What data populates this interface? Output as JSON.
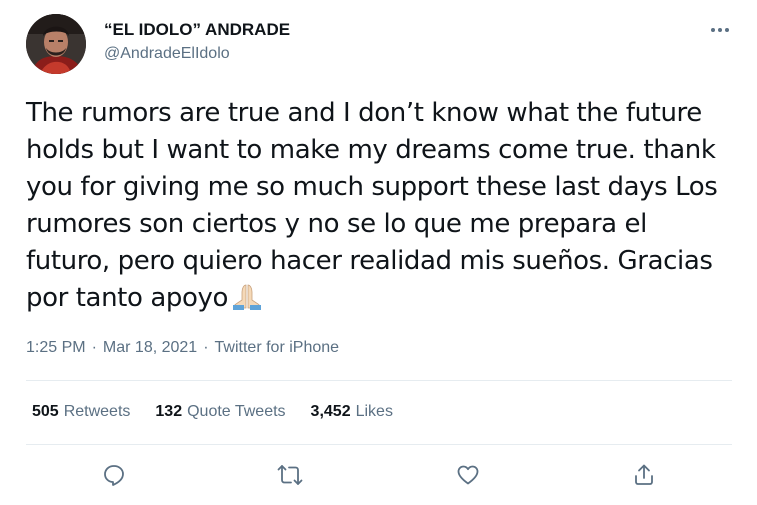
{
  "user": {
    "display_name": "“EL IDOLO” ANDRADE",
    "handle": "@AndradeElIdolo",
    "avatar_icon": "profile-photo"
  },
  "menu": {
    "more_icon": "more-horizontal-icon"
  },
  "tweet": {
    "text": "The rumors are true and I don’t know what the future holds but I want to make my dreams come true. thank you for giving me so much support these last days Los rumores son ciertos y no se lo que me prepara el futuro, pero quiero hacer realidad mis sueños. Gracias por tanto apoyo",
    "emoji": "folded-hands-emoji",
    "time": "1:25 PM",
    "date": "Mar 18, 2021",
    "source": "Twitter for iPhone",
    "separator": "·"
  },
  "stats": {
    "retweets": {
      "count": "505",
      "label": "Retweets"
    },
    "quote_tweets": {
      "count": "132",
      "label": "Quote Tweets"
    },
    "likes": {
      "count": "3,452",
      "label": "Likes"
    }
  },
  "actions": [
    "reply-icon",
    "retweet-icon",
    "like-icon",
    "share-icon"
  ],
  "colors": {
    "text": "#0f1419",
    "secondary": "#5b7083",
    "divider": "#e6ecf0"
  }
}
